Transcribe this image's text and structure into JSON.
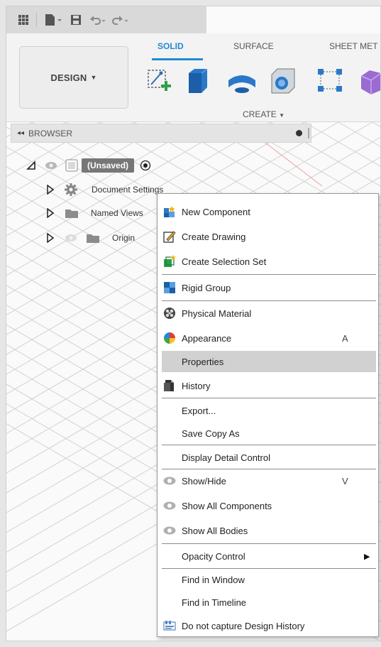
{
  "qat": {
    "icons": [
      "grid-icon",
      "file-icon",
      "save-icon",
      "undo-icon",
      "redo-icon"
    ]
  },
  "toolbar": {
    "design_label": "DESIGN",
    "tabs": [
      "SOLID",
      "SURFACE",
      "SHEET MET"
    ],
    "active_tab": "SOLID",
    "create_label": "CREATE",
    "accent_color": "#1f8ad4"
  },
  "browser": {
    "title": "BROWSER",
    "root_label": "(Unsaved)",
    "items": [
      {
        "label": "Document Settings"
      },
      {
        "label": "Named Views"
      },
      {
        "label": "Origin"
      }
    ]
  },
  "context_menu": {
    "items": [
      {
        "label": "New Component",
        "icon": "new-component-icon"
      },
      {
        "label": "Create Drawing",
        "icon": "create-drawing-icon"
      },
      {
        "label": "Create Selection Set",
        "icon": "selection-set-icon"
      },
      {
        "label": "Rigid Group",
        "icon": "rigid-group-icon"
      },
      {
        "label": "Physical Material",
        "icon": "physical-material-icon"
      },
      {
        "label": "Appearance",
        "icon": "appearance-icon",
        "shortcut": "A"
      },
      {
        "label": "Properties",
        "highlighted": true
      },
      {
        "label": "History",
        "icon": "history-icon"
      },
      {
        "label": "Export..."
      },
      {
        "label": "Save Copy As"
      },
      {
        "label": "Display Detail Control"
      },
      {
        "label": "Show/Hide",
        "icon": "eye-icon",
        "shortcut": "V"
      },
      {
        "label": "Show All Components",
        "icon": "eye-icon"
      },
      {
        "label": "Show All Bodies",
        "icon": "eye-icon"
      },
      {
        "label": "Opacity Control",
        "submenu": true
      },
      {
        "label": "Find in Window"
      },
      {
        "label": "Find in Timeline"
      },
      {
        "label": "Do not capture Design History",
        "icon": "design-history-icon"
      }
    ]
  }
}
